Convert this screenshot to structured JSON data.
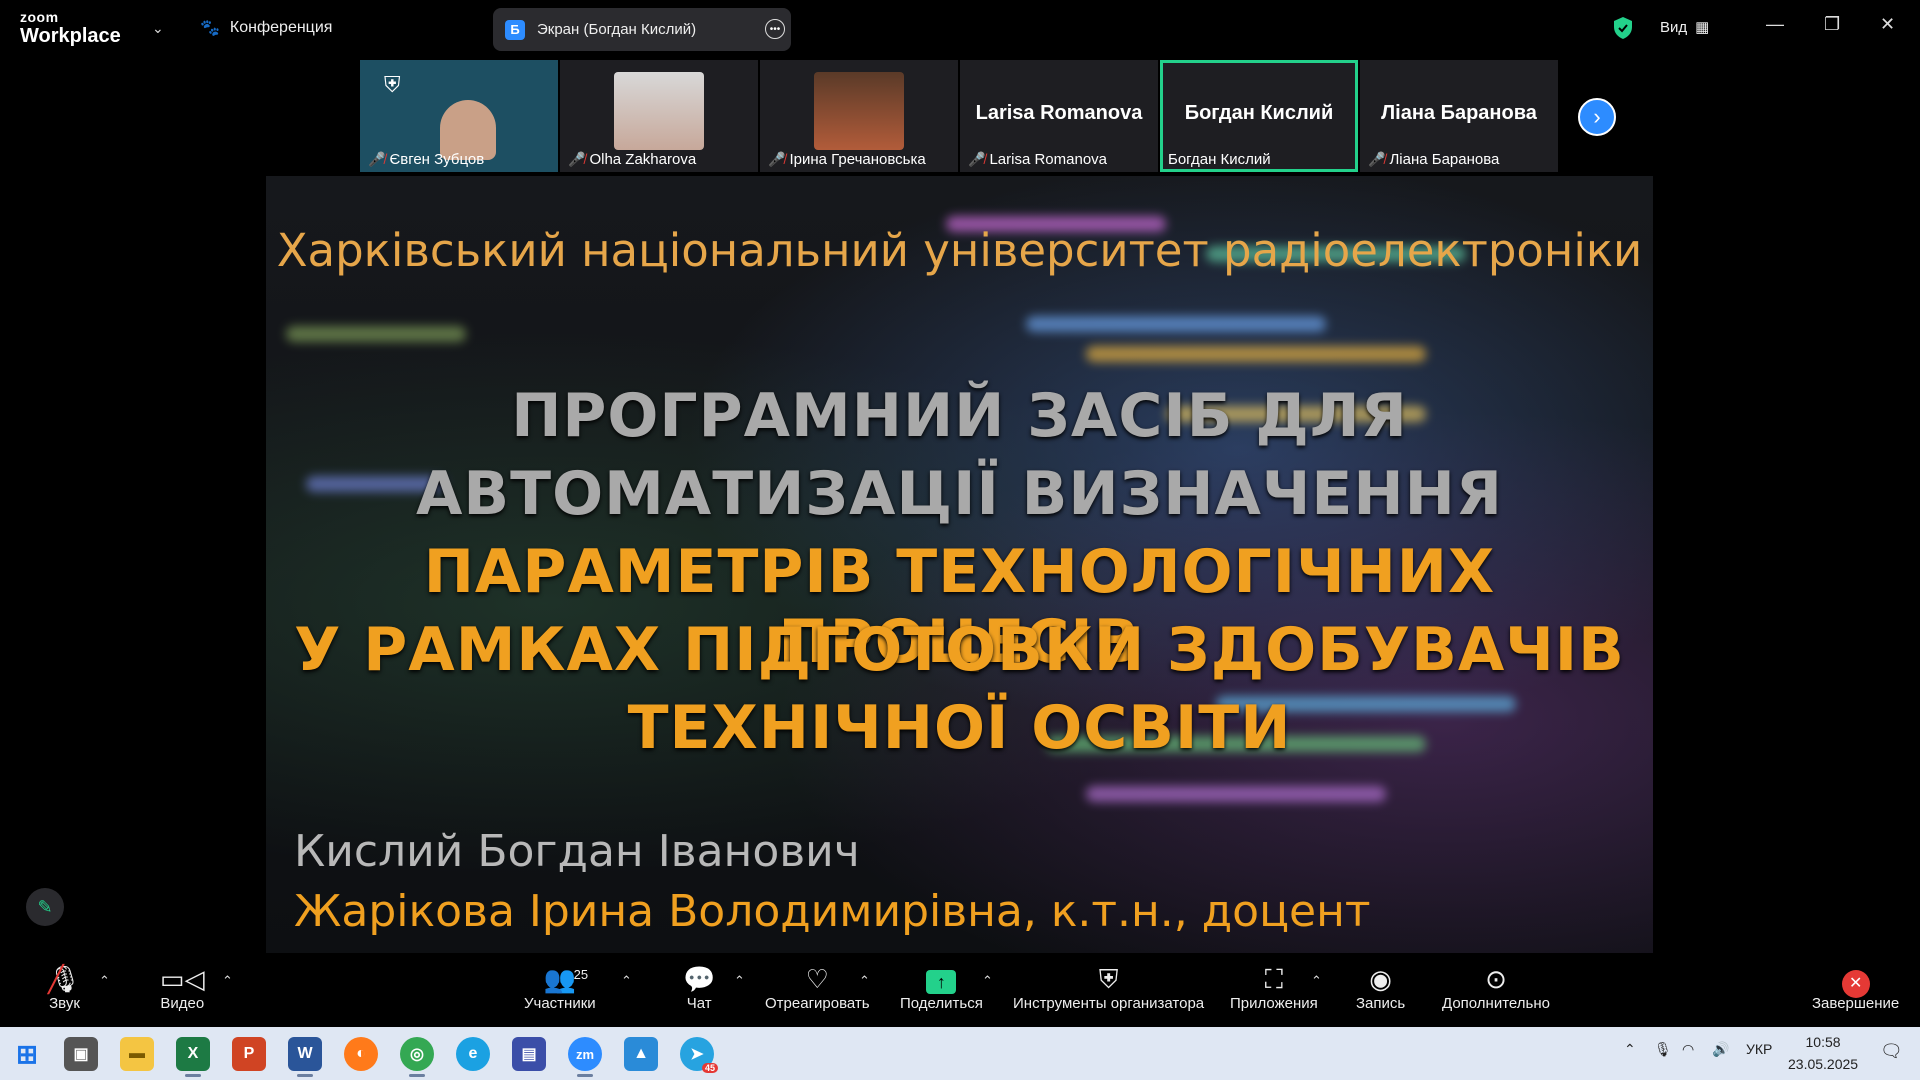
{
  "app": {
    "logo_top": "zoom",
    "logo_bottom": "Workplace",
    "conference_label": "Конференция"
  },
  "screen_share": {
    "badge": "Б",
    "label": "Экран (Богдан Кислий)"
  },
  "topright": {
    "view_label": "Вид"
  },
  "participants_strip": [
    {
      "name": "Євген Зубцов",
      "muted": true,
      "type": "video"
    },
    {
      "name": "Olha Zakharova",
      "muted": true,
      "type": "photo"
    },
    {
      "name": "Ірина Гречановська",
      "muted": true,
      "type": "photo"
    },
    {
      "name": "Larisa Romanova",
      "display": "Larisa Romanova",
      "muted": true,
      "type": "name"
    },
    {
      "name": "Богдан Кислий",
      "display": "Богдан Кислий",
      "muted": false,
      "type": "name",
      "active": true
    },
    {
      "name": "Ліана Баранова",
      "display": "Ліана Баранова",
      "muted": true,
      "type": "name"
    }
  ],
  "slide": {
    "university": "Харківський національний університет радіоелектроніки",
    "title_lines": [
      {
        "text": "ПРОГРАМНИЙ ЗАСІБ ДЛЯ",
        "color": "grey"
      },
      {
        "text": "АВТОМАТИЗАЦІЇ ВИЗНАЧЕННЯ",
        "color": "grey"
      },
      {
        "text": "ПАРАМЕТРІВ ТЕХНОЛОГІЧНИХ ПРОЦЕСІВ",
        "color": "orange"
      },
      {
        "text": "У РАМКАХ ПІДГОТОВКИ ЗДОБУВАЧІВ",
        "color": "orange"
      },
      {
        "text": "ТЕХНІЧНОЇ ОСВІТИ",
        "color": "orange"
      }
    ],
    "author1": "Кислий Богдан Іванович",
    "author2": "Жарікова Ірина Володимирівна, к.т.н., доцент"
  },
  "toolbar": {
    "audio": "Звук",
    "video": "Видео",
    "participants": "Участники",
    "participants_count": "25",
    "chat": "Чат",
    "react": "Отреагировать",
    "share": "Поделиться",
    "host_tools": "Инструменты организатора",
    "apps": "Приложения",
    "record": "Запись",
    "more": "Дополнительно",
    "end": "Завершение"
  },
  "taskbar": {
    "lang": "УКР",
    "time": "10:58",
    "date": "23.05.2025",
    "telegram_badge": "45"
  },
  "colors": {
    "accent_green": "#23d18b",
    "zoom_blue": "#2d8cff",
    "mute_red": "#e53935",
    "slide_orange": "#f0a020"
  }
}
